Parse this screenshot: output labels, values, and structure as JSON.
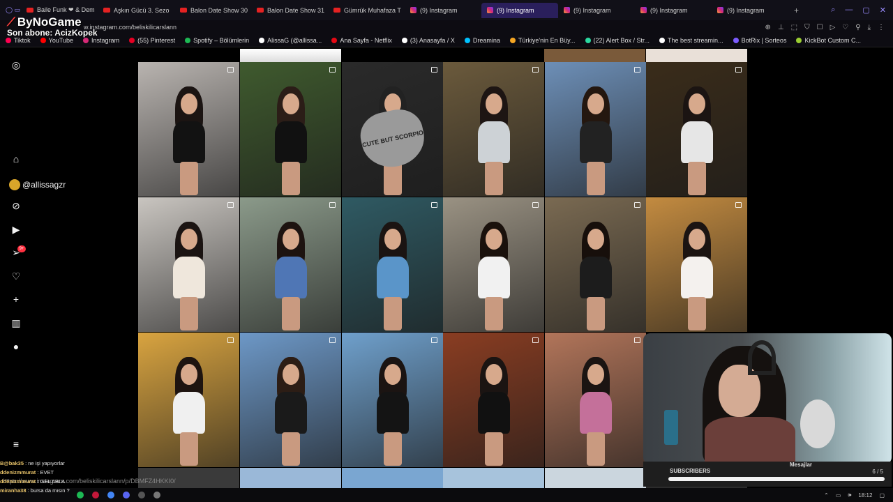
{
  "tabs": [
    {
      "label": "Baile Funk ❤ & Dem",
      "kind": "yt"
    },
    {
      "label": "Aşkın Gücü 3. Sezo",
      "kind": "yt"
    },
    {
      "label": "Balon Date Show 30",
      "kind": "yt"
    },
    {
      "label": "Balon Date Show 31",
      "kind": "yt"
    },
    {
      "label": "Gümrük Muhafaza T",
      "kind": "yt"
    },
    {
      "label": "(9) Instagram",
      "kind": "ig"
    },
    {
      "label": "(9) Instagram",
      "kind": "ig",
      "active": true
    },
    {
      "label": "(9) Instagram",
      "kind": "ig"
    },
    {
      "label": "(9) Instagram",
      "kind": "ig"
    },
    {
      "label": "(9) Instagram",
      "kind": "ig"
    }
  ],
  "address": {
    "url": "w.instagram.com/beliskilicarslann"
  },
  "overlay": {
    "brand": "ByNoGame",
    "subscriber": "Son abone: AcizKopek"
  },
  "bookmarks": [
    "Tiktok",
    "YouTube",
    "Instagram",
    "(55) Pinterest",
    "Spotify – Bölümlerin",
    "AlissaG (@allissa...",
    "Ana Sayfa - Netflix",
    "(3) Anasayfa / X",
    "Dreamina",
    "Türkiye'nin En Büy...",
    "(22) Alert Box / Str...",
    "The best streamin...",
    "BotRix | Sorteos",
    "KickBot Custom C..."
  ],
  "sidebar": {
    "handle": "@allissagzr",
    "notification_count": "9+"
  },
  "chat": [
    {
      "user": "B@bak35",
      "msg": "ne işi yapıyorlar"
    },
    {
      "user": "ddenizmmurat",
      "msg": "EVET"
    },
    {
      "user": "ddenizmmurat",
      "msg": "GEL ABLA"
    },
    {
      "user": "miranha38",
      "msg": "bursa da mısın ?"
    }
  ],
  "status_url": "https://www.instagram.com/beliskilicarslann/p/DBMFZ4HKKI0/",
  "stream_panel": {
    "subscribers_label": "SUBSCRIBERS",
    "messages_label": "Mesajlar",
    "page_counter": "6 / 5"
  },
  "clock": "18:12",
  "grid_cells": [
    {
      "bg": "#b9b4b0",
      "outfit": "#121212",
      "hair": "#1b1412"
    },
    {
      "bg": "#3f5a2e",
      "outfit": "#111",
      "hair": "#2b1d17"
    },
    {
      "bg": "#2a2a2a",
      "outfit": "#8c8c8c",
      "hair": "#222",
      "cake_text": "CUTE BUT SCORPIO"
    },
    {
      "bg": "#6b5a3c",
      "outfit": "#cdd2d6",
      "hair": "#1d1513"
    },
    {
      "bg": "#6d8fb7",
      "outfit": "#222",
      "hair": "#24170f"
    },
    {
      "bg": "#3a2c1a",
      "outfit": "#e6e6e6",
      "hair": "#1b1412"
    },
    {
      "bg": "#c9c5c0",
      "outfit": "#efe7dc",
      "hair": "#1b1412"
    },
    {
      "bg": "#8b9a8a",
      "outfit": "#4f76b5",
      "hair": "#1d1310"
    },
    {
      "bg": "#2f5a63",
      "outfit": "#5a95c9",
      "hair": "#1b1412"
    },
    {
      "bg": "#9a9283",
      "outfit": "#f1f1f1",
      "hair": "#1a110c"
    },
    {
      "bg": "#7a6a52",
      "outfit": "#1c1c1c",
      "hair": "#170f0b"
    },
    {
      "bg": "#c38b40",
      "outfit": "#f4f1ee",
      "hair": "#1b1412"
    },
    {
      "bg": "#d9a440",
      "outfit": "#f0f0f0",
      "hair": "#1e1410"
    },
    {
      "bg": "#6d98c7",
      "outfit": "#1a1a1a",
      "hair": "#2c1d15"
    },
    {
      "bg": "#6fa0cc",
      "outfit": "#141414",
      "hair": "#1b1412"
    },
    {
      "bg": "#8a3d22",
      "outfit": "#111",
      "hair": "#1b1412"
    },
    {
      "bg": "#b2755a",
      "outfit": "#c4709a",
      "hair": "#1b1412"
    }
  ]
}
